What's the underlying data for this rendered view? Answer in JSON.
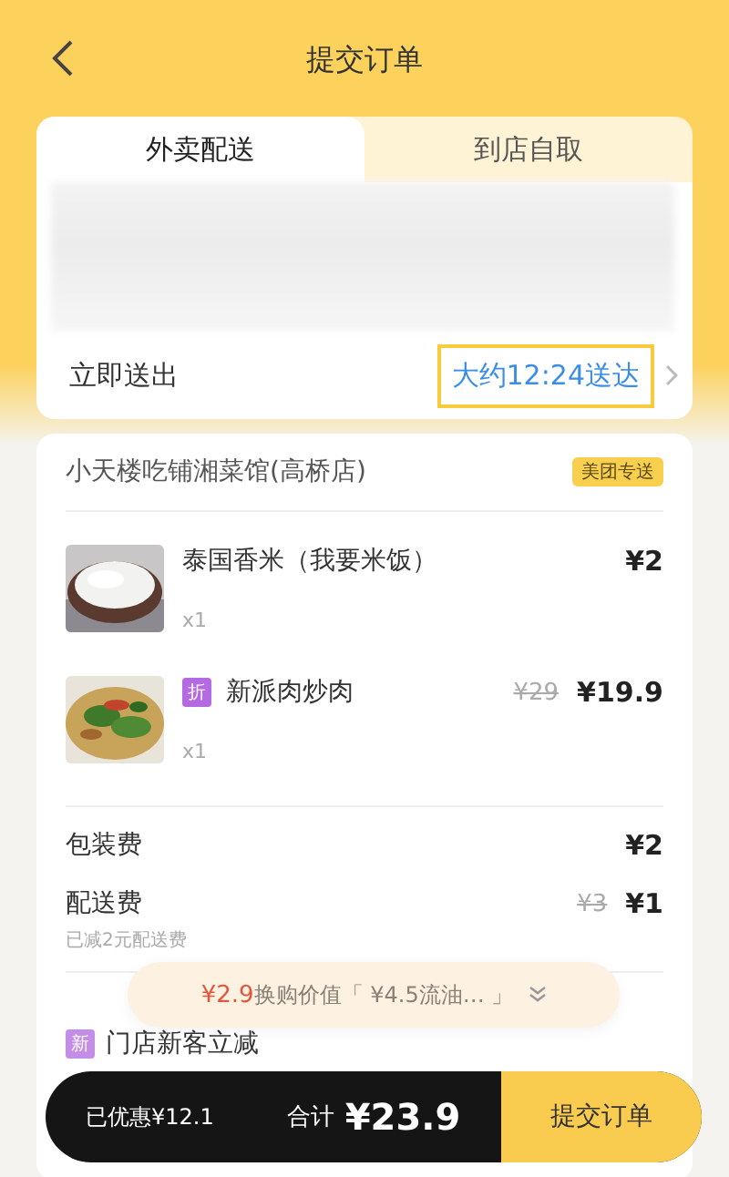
{
  "header": {
    "title": "提交订单"
  },
  "tabs": [
    {
      "label": "外卖配送",
      "selected": true
    },
    {
      "label": "到店自取",
      "selected": false
    }
  ],
  "delivery": {
    "label": "立即送出",
    "time": "大约12:24送达",
    "highlighted": true
  },
  "shop": {
    "name": "小天楼吃铺湘菜馆(高桥店)",
    "badge": "美团专送"
  },
  "items": [
    {
      "name": "泰国香米（我要米饭）",
      "price": "¥2",
      "quantity": "x1"
    },
    {
      "tag": "折",
      "name": "新派肉炒肉",
      "original_price": "¥29",
      "price": "¥19.9",
      "quantity": "x1"
    }
  ],
  "fees": [
    {
      "label": "包装费",
      "price": "¥2"
    },
    {
      "label": "配送费",
      "original_price": "¥3",
      "price": "¥1",
      "note": "已减2元配送费"
    }
  ],
  "promo_pill": {
    "price": "¥2.9",
    "text": "换购价值「 ¥4.5流油… 」"
  },
  "discounts": [
    {
      "tag": "新",
      "label": "门店新客立减"
    }
  ],
  "bottom_bar": {
    "saved": "已优惠¥12.1",
    "total_label": "合计",
    "total": "¥23.9",
    "submit": "提交订单"
  }
}
